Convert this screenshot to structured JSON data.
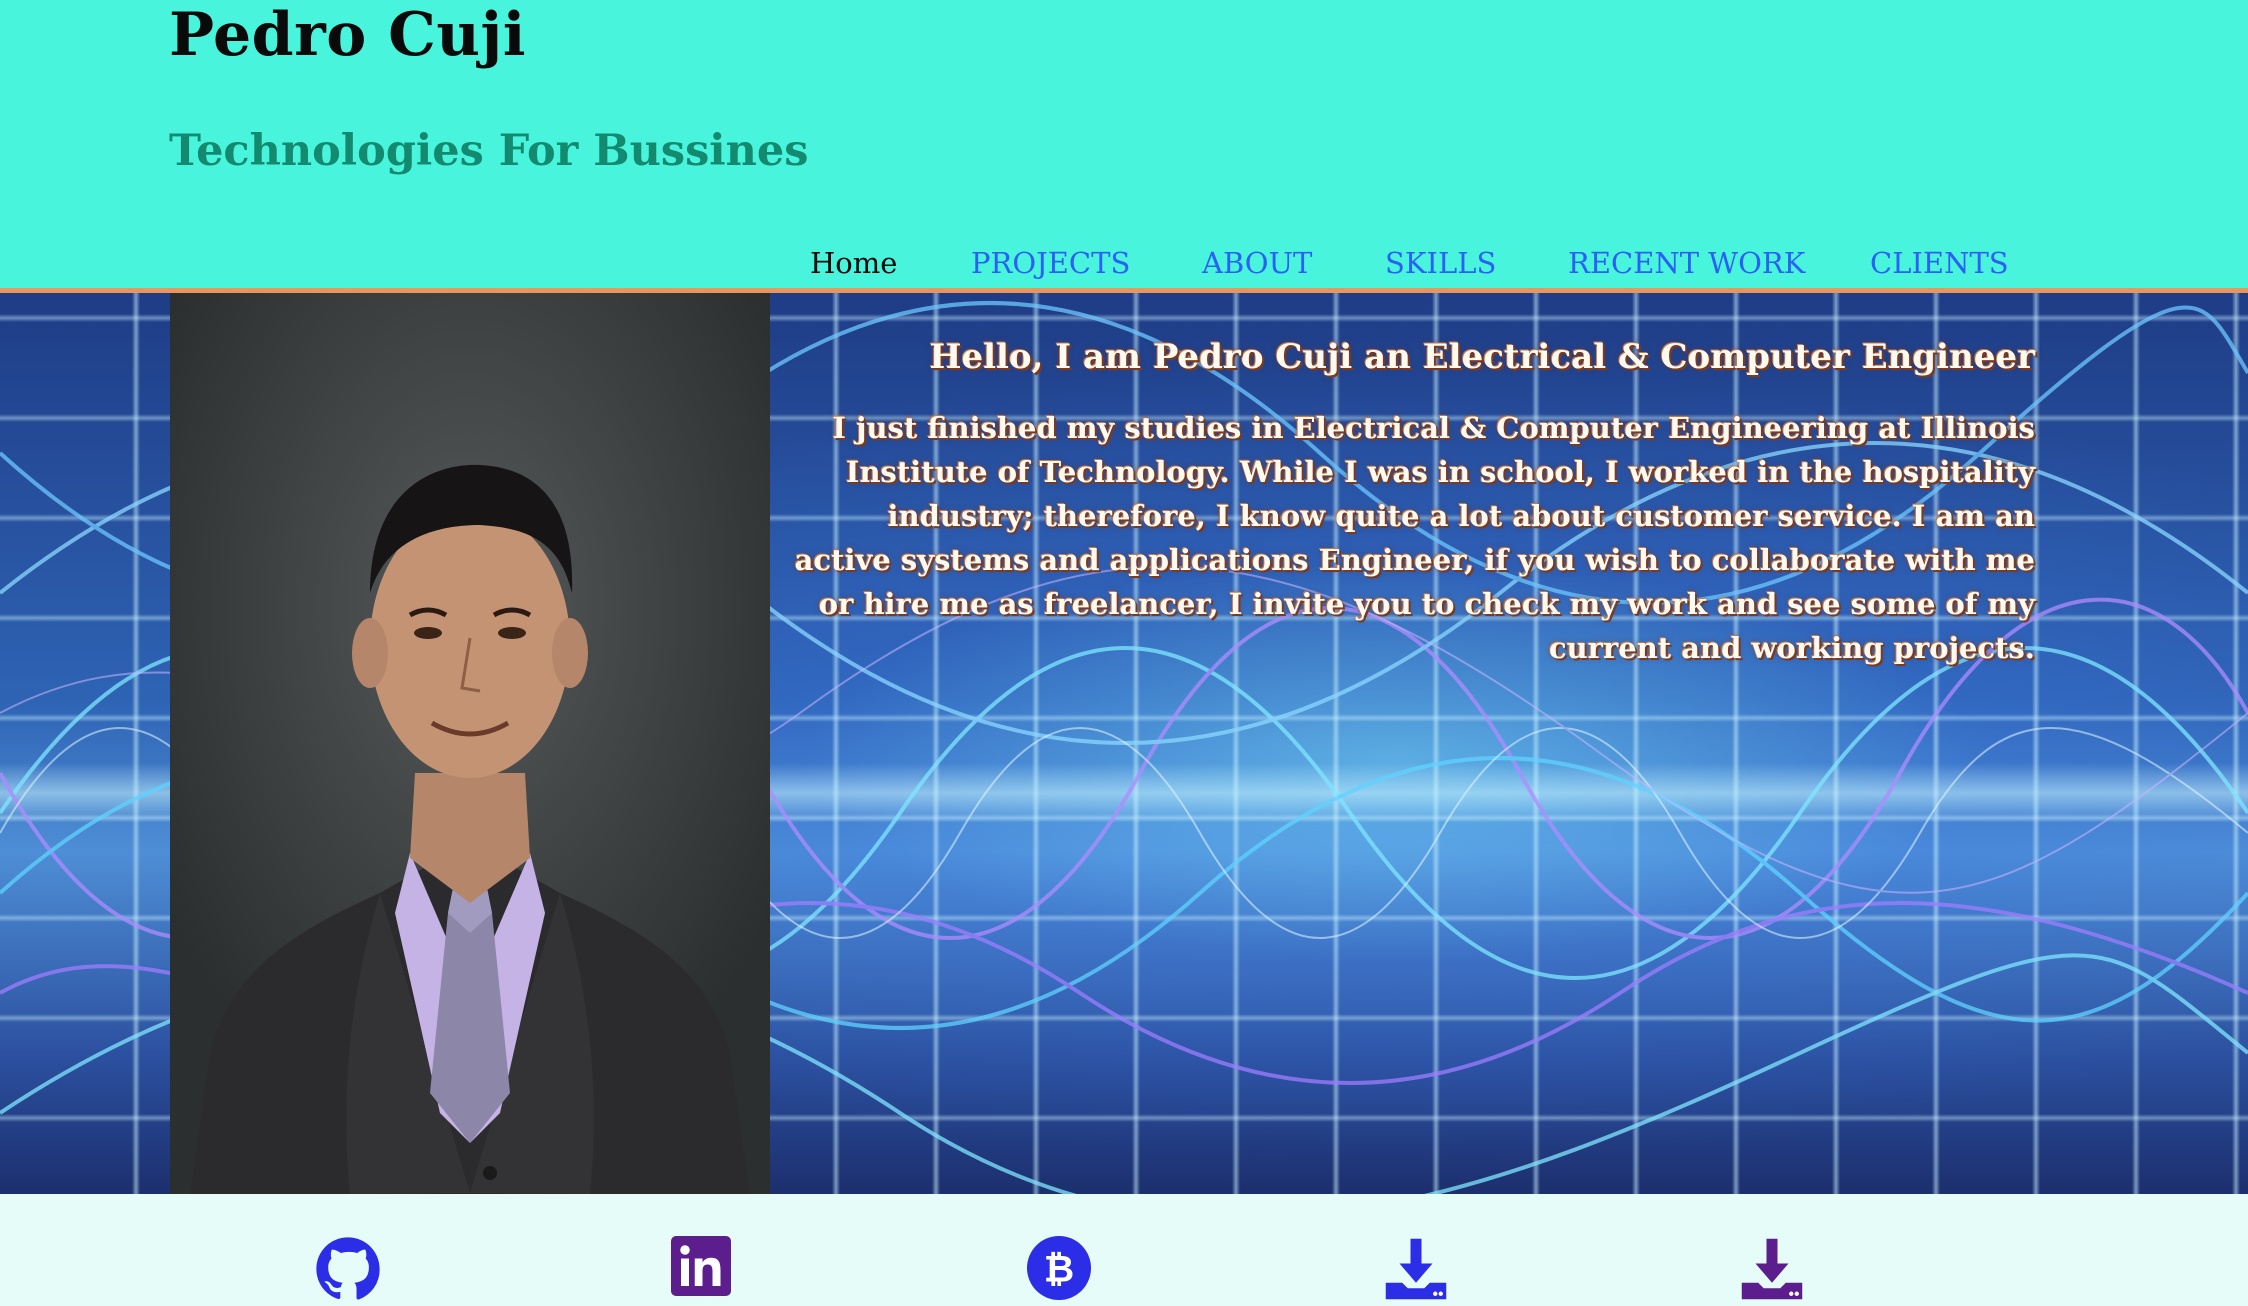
{
  "header": {
    "title": "Pedro Cuji",
    "tagline": "Technologies For Bussines"
  },
  "nav": {
    "items": [
      {
        "label": "Home",
        "active": true
      },
      {
        "label": "PROJECTS",
        "active": false
      },
      {
        "label": "ABOUT",
        "active": false
      },
      {
        "label": "SKILLS",
        "active": false
      },
      {
        "label": "RECENT WORK",
        "active": false
      },
      {
        "label": "CLIENTS",
        "active": false
      }
    ]
  },
  "hero": {
    "heading": "Hello, I am Pedro Cuji an Electrical & Computer Engineer",
    "paragraph": "I just finished my studies in Electrical & Computer Engineering at Illinois Institute of Technology. While I was in school, I worked in the hospitality industry; therefore, I know quite a lot about customer service. I am an active systems and applications Engineer, if you wish to collaborate with me or hire me as freelancer, I invite you to check my work and see some of my current and working projects."
  },
  "footer": {
    "icons": [
      {
        "name": "github-icon",
        "color": "#2b2ee6"
      },
      {
        "name": "linkedin-icon",
        "color": "#5b1e8c"
      },
      {
        "name": "bitcoin-icon",
        "color": "#2b2ee6"
      },
      {
        "name": "download-icon",
        "color": "#2b2ee6"
      },
      {
        "name": "download-icon",
        "color": "#5b1e8c"
      }
    ]
  },
  "colors": {
    "header_bg": "#48f5dc",
    "header_border": "#e79660",
    "tagline": "#138a6f",
    "nav_link": "#2c5ff5",
    "footer_bg": "#e6fcf8"
  }
}
